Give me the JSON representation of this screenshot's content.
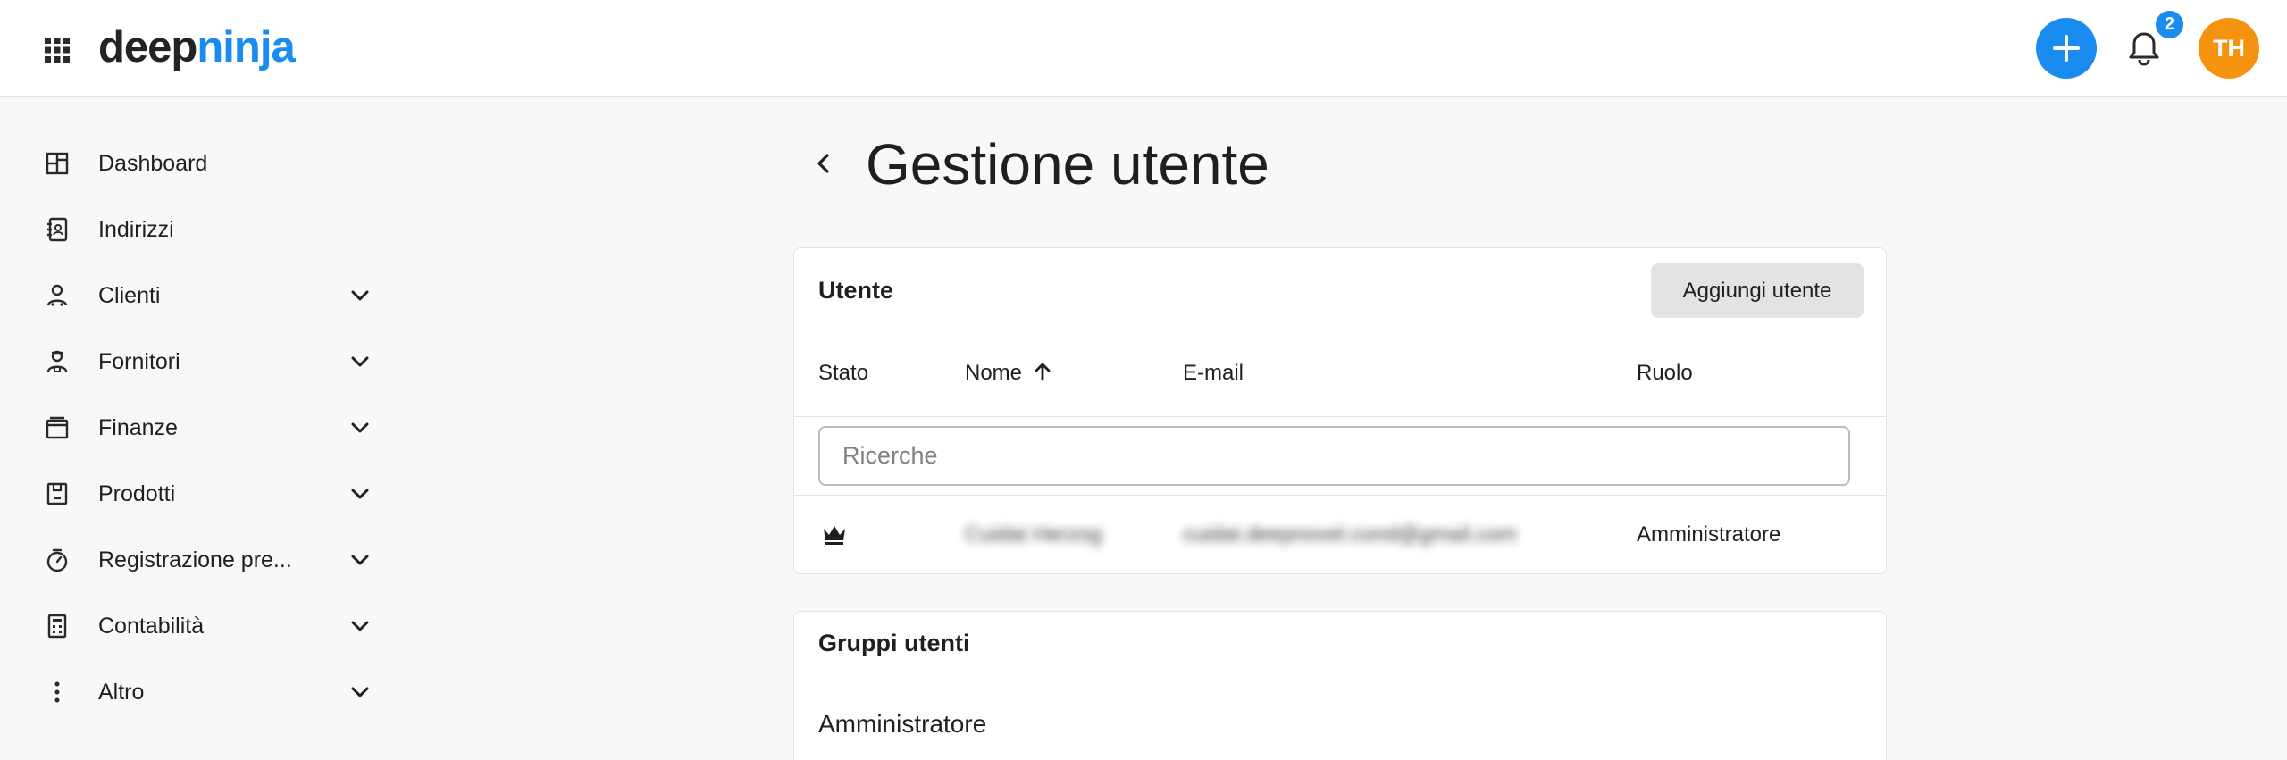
{
  "header": {
    "logo_part1": "deep",
    "logo_part2": "ninja",
    "notification_count": "2",
    "avatar_initials": "TH",
    "brand_color": "#1a8cf0",
    "avatar_color": "#f5930f"
  },
  "sidebar": {
    "items": [
      {
        "label": "Dashboard",
        "icon": "dashboard-icon",
        "expandable": false
      },
      {
        "label": "Indirizzi",
        "icon": "address-book-icon",
        "expandable": false
      },
      {
        "label": "Clienti",
        "icon": "customers-icon",
        "expandable": true
      },
      {
        "label": "Fornitori",
        "icon": "suppliers-icon",
        "expandable": true
      },
      {
        "label": "Finanze",
        "icon": "wallet-icon",
        "expandable": true
      },
      {
        "label": "Prodotti",
        "icon": "product-box-icon",
        "expandable": true
      },
      {
        "label": "Registrazione pre...",
        "icon": "timer-icon",
        "expandable": true
      },
      {
        "label": "Contabilità",
        "icon": "calculator-icon",
        "expandable": true
      },
      {
        "label": "Altro",
        "icon": "more-vertical-icon",
        "expandable": true
      }
    ]
  },
  "main": {
    "title": "Gestione utente",
    "users_card": {
      "title": "Utente",
      "add_button": "Aggiungi utente",
      "columns": {
        "status": "Stato",
        "name": "Nome",
        "email": "E-mail",
        "role": "Ruolo"
      },
      "search_placeholder": "Ricerche",
      "rows": [
        {
          "status_icon": "crown-icon",
          "name": "Cuidat Herzog",
          "email": "cuidat.deepnovel.cond@gmail.com",
          "role": "Amministratore"
        }
      ]
    },
    "groups_card": {
      "title": "Gruppi utenti",
      "items": [
        "Amministratore"
      ]
    }
  }
}
